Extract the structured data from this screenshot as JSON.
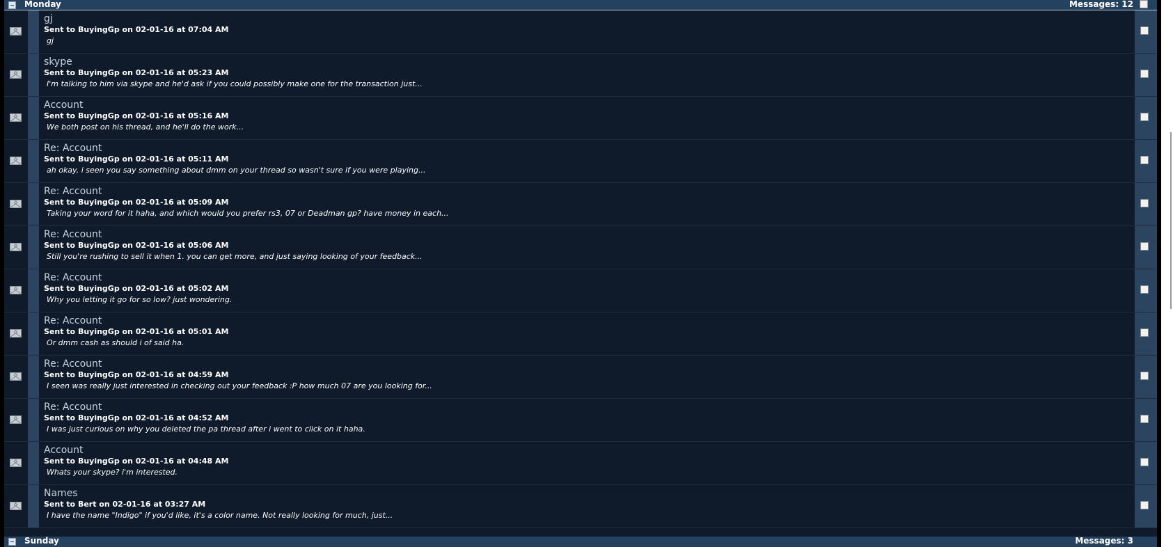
{
  "groups": {
    "monday": {
      "title": "Monday",
      "count_label": "Messages: 12"
    },
    "sunday": {
      "title": "Sunday",
      "count_label": "Messages: 3"
    }
  },
  "messages": [
    {
      "subject": "gj",
      "sent": "Sent to BuyingGp on 02-01-16 at 07:04 AM",
      "preview": "gj"
    },
    {
      "subject": "skype",
      "sent": "Sent to BuyingGp on 02-01-16 at 05:23 AM",
      "preview": "I'm talking to him via skype and he'd ask if you could possibly make one for the transaction just..."
    },
    {
      "subject": "Account",
      "sent": "Sent to BuyingGp on 02-01-16 at 05:16 AM",
      "preview": "We both post on his thread, and he'll do the work..."
    },
    {
      "subject": "Re: Account",
      "sent": "Sent to BuyingGp on 02-01-16 at 05:11 AM",
      "preview": "ah okay, i seen you say something about dmm on your thread so wasn't sure if you were playing..."
    },
    {
      "subject": "Re: Account",
      "sent": "Sent to BuyingGp on 02-01-16 at 05:09 AM",
      "preview": "Taking your word for it haha, and which would you prefer rs3, 07 or Deadman gp? have money in each..."
    },
    {
      "subject": "Re: Account",
      "sent": "Sent to BuyingGp on 02-01-16 at 05:06 AM",
      "preview": "Still you're rushing to sell it when 1. you can get more, and just saying looking of your feedback..."
    },
    {
      "subject": "Re: Account",
      "sent": "Sent to BuyingGp on 02-01-16 at 05:02 AM",
      "preview": "Why you letting it go for so low? just wondering."
    },
    {
      "subject": "Re: Account",
      "sent": "Sent to BuyingGp on 02-01-16 at 05:01 AM",
      "preview": "Or dmm cash as should i of said ha."
    },
    {
      "subject": "Re: Account",
      "sent": "Sent to BuyingGp on 02-01-16 at 04:59 AM",
      "preview": "I seen was really just interested in checking out your feedback :P how much 07 are you looking for..."
    },
    {
      "subject": "Re: Account",
      "sent": "Sent to BuyingGp on 02-01-16 at 04:52 AM",
      "preview": "I was just curious on why you deleted the pa thread after i went to click on it haha."
    },
    {
      "subject": "Account",
      "sent": "Sent to BuyingGp on 02-01-16 at 04:48 AM",
      "preview": "Whats your skype? i'm interested."
    },
    {
      "subject": "Names",
      "sent": "Sent to Bert on 02-01-16 at 03:27 AM",
      "preview": "I have the name \"Indigo\" if you'd like, it's a color name. Not really looking for much, just..."
    }
  ]
}
